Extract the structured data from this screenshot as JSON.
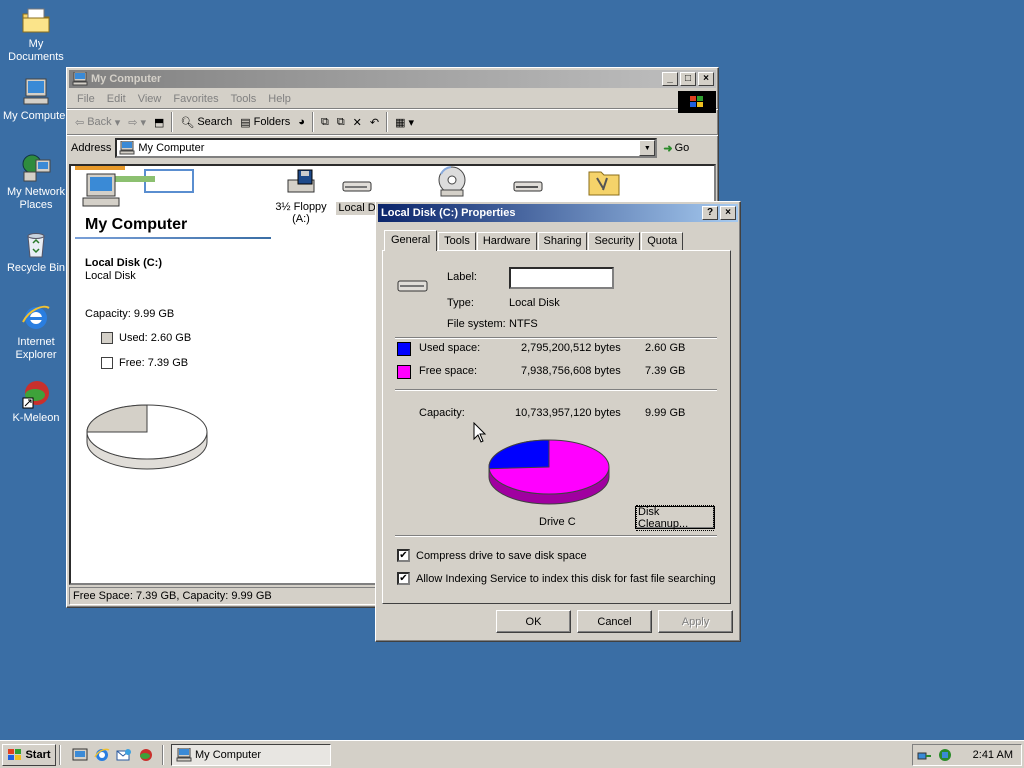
{
  "desktop": {
    "icons": [
      {
        "label": "My Documents",
        "icon": "folder-documents-icon"
      },
      {
        "label": "My Computer",
        "icon": "computer-icon"
      },
      {
        "label": "My Network Places",
        "icon": "network-icon"
      },
      {
        "label": "Recycle Bin",
        "icon": "recycle-bin-icon"
      },
      {
        "label": "Internet Explorer",
        "icon": "ie-icon"
      },
      {
        "label": "K-Meleon",
        "icon": "kmeleon-icon"
      }
    ]
  },
  "explorer": {
    "title": "My Computer",
    "menu": [
      "File",
      "Edit",
      "View",
      "Favorites",
      "Tools",
      "Help"
    ],
    "toolbar": {
      "back": "Back",
      "search": "Search",
      "folders": "Folders"
    },
    "address_label": "Address",
    "address_value": "My Computer",
    "go_label": "Go",
    "side_title": "My Computer",
    "side_drive_name": "Local Disk (C:)",
    "side_drive_type": "Local Disk",
    "side_capacity": "Capacity: 9.99 GB",
    "side_used": "Used: 2.60 GB",
    "side_free": "Free: 7.39 GB",
    "items": [
      {
        "label": "3½ Floppy (A:)",
        "icon": "floppy-icon"
      },
      {
        "label": "Local D",
        "icon": "hard-disk-icon"
      },
      {
        "label": "",
        "icon": "cd-drive-icon"
      },
      {
        "label": "",
        "icon": "drive-icon"
      },
      {
        "label": "",
        "icon": "control-panel-icon"
      }
    ],
    "status": "Free Space: 7.39 GB, Capacity: 9.99 GB"
  },
  "dialog": {
    "title": "Local Disk (C:) Properties",
    "tabs": [
      "General",
      "Tools",
      "Hardware",
      "Sharing",
      "Security",
      "Quota"
    ],
    "label_caption": "Label:",
    "label_value": "",
    "type_caption": "Type:",
    "type_value": "Local Disk",
    "fs_caption": "File system:",
    "fs_value": "NTFS",
    "used_caption": "Used space:",
    "used_bytes": "2,795,200,512 bytes",
    "used_gb": "2.60 GB",
    "free_caption": "Free space:",
    "free_bytes": "7,938,756,608 bytes",
    "free_gb": "7.39 GB",
    "capacity_caption": "Capacity:",
    "capacity_bytes": "10,733,957,120 bytes",
    "capacity_gb": "9.99 GB",
    "drive_caption": "Drive C",
    "cleanup_button": "Disk Cleanup...",
    "compress_label": "Compress drive to save disk space",
    "index_label": "Allow Indexing Service to index this disk for fast file searching",
    "compress_checked": true,
    "index_checked": true,
    "ok": "OK",
    "cancel": "Cancel",
    "apply": "Apply",
    "used_fraction": 0.26,
    "colors": {
      "used": "#0000ff",
      "free": "#ff00ff"
    }
  },
  "taskbar": {
    "start": "Start",
    "task": "My Computer",
    "clock": "2:41 AM"
  }
}
